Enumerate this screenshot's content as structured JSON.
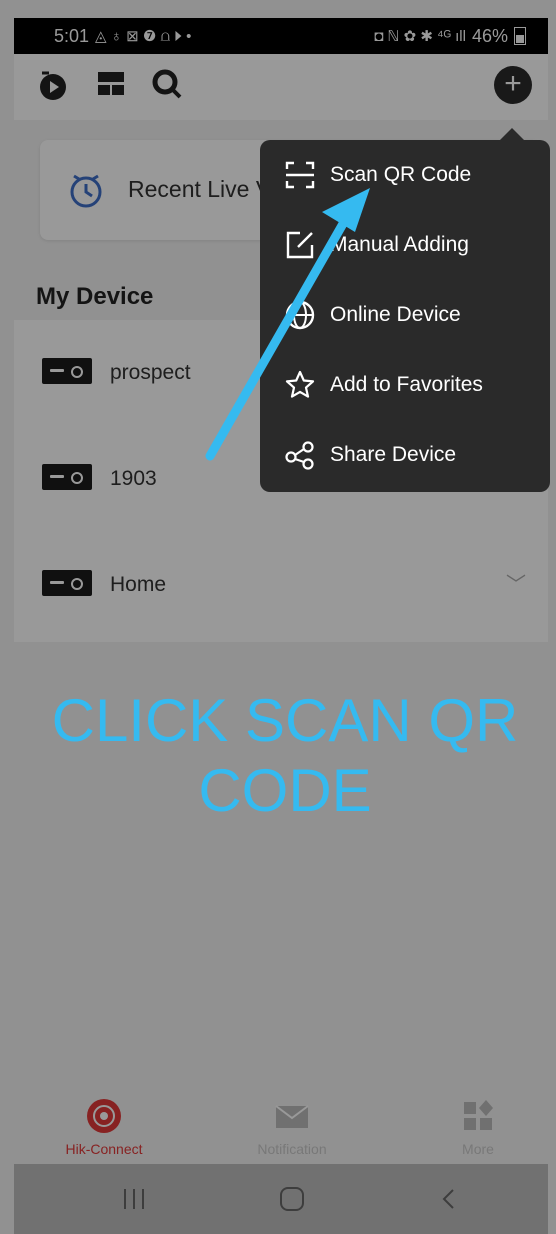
{
  "status_bar": {
    "time": "5:01",
    "left_glyphs": "◬ ♁ ⊠ ❼ ⩍ ⏵ •",
    "right_glyphs": "◘ ℕ ✿ ✱ ⁴ᴳ ıll",
    "battery": "46%"
  },
  "toolbar": {
    "icons": [
      "playback-icon",
      "layout-icon",
      "search-icon",
      "add-icon"
    ]
  },
  "recent_live_view": {
    "label": "Recent Live View",
    "icon": "clock-icon"
  },
  "my_device": {
    "heading": "My Device",
    "devices": [
      {
        "name": "prospect"
      },
      {
        "name": "1903"
      },
      {
        "name": "Home"
      }
    ]
  },
  "popup_menu": {
    "items": [
      {
        "label": "Scan QR Code",
        "icon": "scan-qr-icon"
      },
      {
        "label": "Manual Adding",
        "icon": "edit-icon"
      },
      {
        "label": "Online Device",
        "icon": "globe-icon"
      },
      {
        "label": "Add to Favorites",
        "icon": "star-icon"
      },
      {
        "label": "Share Device",
        "icon": "share-icon"
      }
    ]
  },
  "annotation": {
    "caption_line1": "CLICK SCAN QR",
    "caption_line2": "CODE",
    "arrow_color": "#35baf0"
  },
  "tab_bar": {
    "tabs": [
      {
        "label": "Hik-Connect",
        "icon": "hik-connect-icon",
        "active": true
      },
      {
        "label": "Notification",
        "icon": "mail-icon",
        "active": false
      },
      {
        "label": "More",
        "icon": "more-icon",
        "active": false
      }
    ],
    "active_color": "#e23a3a"
  },
  "nav_bar": {
    "buttons": [
      "recent-apps",
      "home",
      "back"
    ]
  }
}
